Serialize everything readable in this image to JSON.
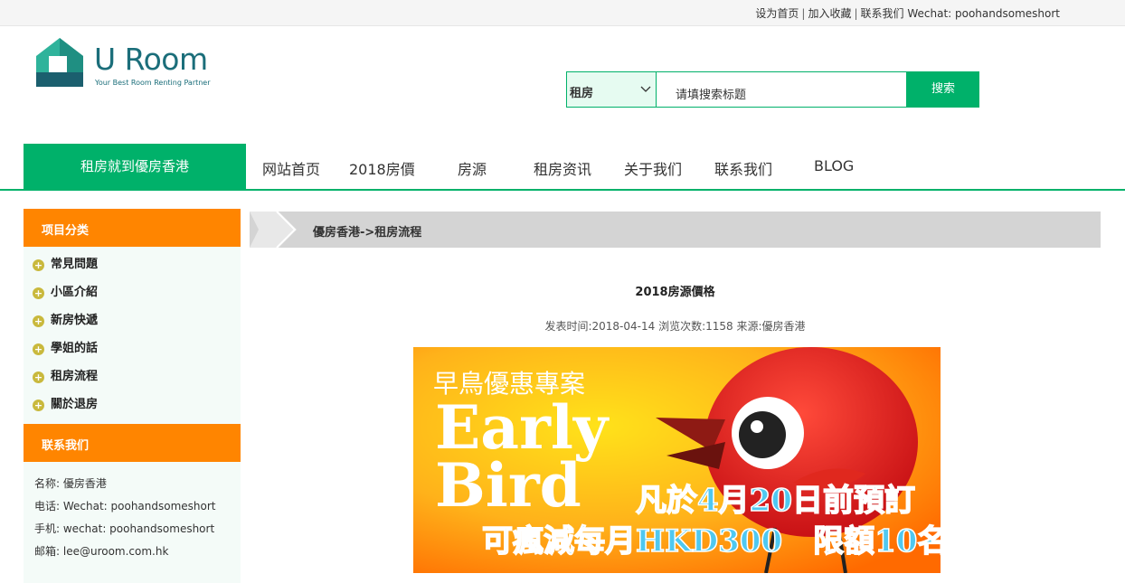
{
  "topbar": {
    "set_home": "设为首页",
    "add_favorite": "加入收藏",
    "contact": "联系我们 Wechat: poohandsomeshort",
    "separator": "|"
  },
  "logo": {
    "wordmark": "U Room",
    "tagline": "Your Best Room Renting Partner",
    "icon": "house-icon",
    "colors": {
      "teal": "#1b6e7a",
      "green": "#2fb39b"
    }
  },
  "search": {
    "category": "租房",
    "placeholder": "请填搜索标题",
    "button": "搜索"
  },
  "nav": {
    "brand": "租房就到優房香港",
    "items": [
      "网站首页",
      "2018房價",
      "房源",
      "租房资讯",
      "关于我们",
      "联系我们",
      "BLOG"
    ]
  },
  "sidebar": {
    "category_title": "项目分类",
    "items": [
      "常見問題",
      "小區介紹",
      "新房快遞",
      "學姐的話",
      "租房流程",
      "關於退房"
    ],
    "contact_title": "联系我们",
    "contact": [
      "名称: 優房香港",
      "电话: Wechat: poohandsomeshort",
      "手机: wechat: poohandsomeshort",
      "邮箱: lee@uroom.com.hk"
    ]
  },
  "breadcrumb": "優房香港->租房流程",
  "article": {
    "title": "2018房源價格",
    "meta": "发表时间:2018-04-14 浏览次数:1158 来源:優房香港"
  },
  "banner": {
    "headline": "早鳥優惠專案",
    "line1": "Early",
    "line2": "Bird",
    "offer1": "凡於4月20日前預訂",
    "offer2": "可瘋減每月HKD300　限額10名"
  },
  "colors": {
    "green": "#00b16a",
    "orange": "#ff8500",
    "sidebar_bg": "#f4fbf8",
    "crumb_bg": "#d4d4d4"
  }
}
